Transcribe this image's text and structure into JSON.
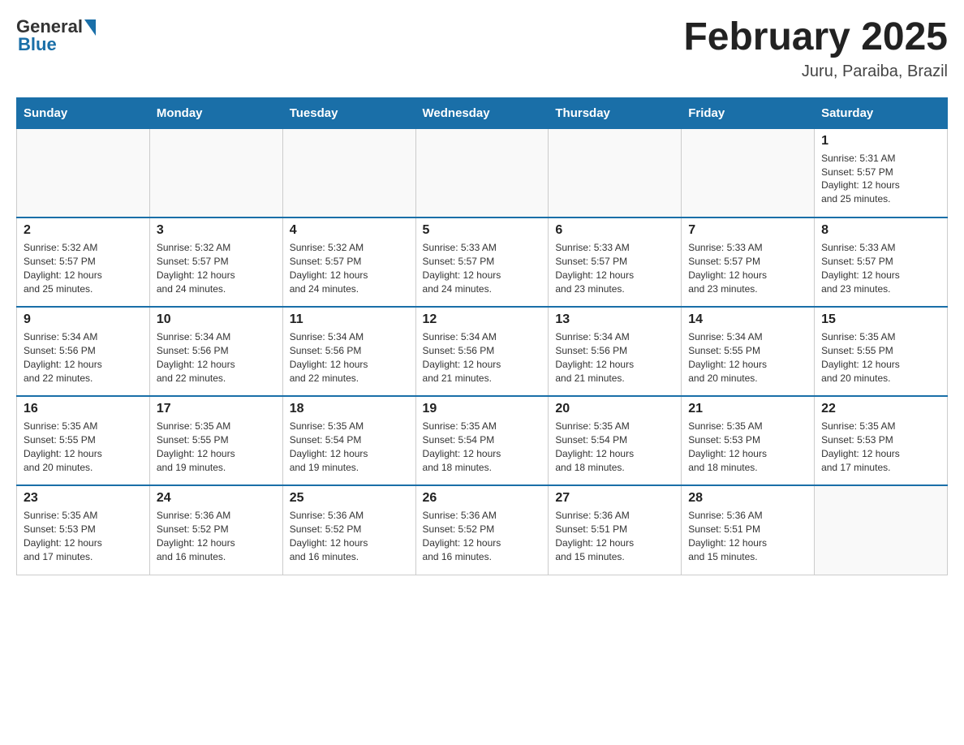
{
  "header": {
    "logo_general": "General",
    "logo_blue": "Blue",
    "month_title": "February 2025",
    "subtitle": "Juru, Paraiba, Brazil"
  },
  "weekdays": [
    "Sunday",
    "Monday",
    "Tuesday",
    "Wednesday",
    "Thursday",
    "Friday",
    "Saturday"
  ],
  "weeks": [
    [
      {
        "day": "",
        "info": ""
      },
      {
        "day": "",
        "info": ""
      },
      {
        "day": "",
        "info": ""
      },
      {
        "day": "",
        "info": ""
      },
      {
        "day": "",
        "info": ""
      },
      {
        "day": "",
        "info": ""
      },
      {
        "day": "1",
        "info": "Sunrise: 5:31 AM\nSunset: 5:57 PM\nDaylight: 12 hours\nand 25 minutes."
      }
    ],
    [
      {
        "day": "2",
        "info": "Sunrise: 5:32 AM\nSunset: 5:57 PM\nDaylight: 12 hours\nand 25 minutes."
      },
      {
        "day": "3",
        "info": "Sunrise: 5:32 AM\nSunset: 5:57 PM\nDaylight: 12 hours\nand 24 minutes."
      },
      {
        "day": "4",
        "info": "Sunrise: 5:32 AM\nSunset: 5:57 PM\nDaylight: 12 hours\nand 24 minutes."
      },
      {
        "day": "5",
        "info": "Sunrise: 5:33 AM\nSunset: 5:57 PM\nDaylight: 12 hours\nand 24 minutes."
      },
      {
        "day": "6",
        "info": "Sunrise: 5:33 AM\nSunset: 5:57 PM\nDaylight: 12 hours\nand 23 minutes."
      },
      {
        "day": "7",
        "info": "Sunrise: 5:33 AM\nSunset: 5:57 PM\nDaylight: 12 hours\nand 23 minutes."
      },
      {
        "day": "8",
        "info": "Sunrise: 5:33 AM\nSunset: 5:57 PM\nDaylight: 12 hours\nand 23 minutes."
      }
    ],
    [
      {
        "day": "9",
        "info": "Sunrise: 5:34 AM\nSunset: 5:56 PM\nDaylight: 12 hours\nand 22 minutes."
      },
      {
        "day": "10",
        "info": "Sunrise: 5:34 AM\nSunset: 5:56 PM\nDaylight: 12 hours\nand 22 minutes."
      },
      {
        "day": "11",
        "info": "Sunrise: 5:34 AM\nSunset: 5:56 PM\nDaylight: 12 hours\nand 22 minutes."
      },
      {
        "day": "12",
        "info": "Sunrise: 5:34 AM\nSunset: 5:56 PM\nDaylight: 12 hours\nand 21 minutes."
      },
      {
        "day": "13",
        "info": "Sunrise: 5:34 AM\nSunset: 5:56 PM\nDaylight: 12 hours\nand 21 minutes."
      },
      {
        "day": "14",
        "info": "Sunrise: 5:34 AM\nSunset: 5:55 PM\nDaylight: 12 hours\nand 20 minutes."
      },
      {
        "day": "15",
        "info": "Sunrise: 5:35 AM\nSunset: 5:55 PM\nDaylight: 12 hours\nand 20 minutes."
      }
    ],
    [
      {
        "day": "16",
        "info": "Sunrise: 5:35 AM\nSunset: 5:55 PM\nDaylight: 12 hours\nand 20 minutes."
      },
      {
        "day": "17",
        "info": "Sunrise: 5:35 AM\nSunset: 5:55 PM\nDaylight: 12 hours\nand 19 minutes."
      },
      {
        "day": "18",
        "info": "Sunrise: 5:35 AM\nSunset: 5:54 PM\nDaylight: 12 hours\nand 19 minutes."
      },
      {
        "day": "19",
        "info": "Sunrise: 5:35 AM\nSunset: 5:54 PM\nDaylight: 12 hours\nand 18 minutes."
      },
      {
        "day": "20",
        "info": "Sunrise: 5:35 AM\nSunset: 5:54 PM\nDaylight: 12 hours\nand 18 minutes."
      },
      {
        "day": "21",
        "info": "Sunrise: 5:35 AM\nSunset: 5:53 PM\nDaylight: 12 hours\nand 18 minutes."
      },
      {
        "day": "22",
        "info": "Sunrise: 5:35 AM\nSunset: 5:53 PM\nDaylight: 12 hours\nand 17 minutes."
      }
    ],
    [
      {
        "day": "23",
        "info": "Sunrise: 5:35 AM\nSunset: 5:53 PM\nDaylight: 12 hours\nand 17 minutes."
      },
      {
        "day": "24",
        "info": "Sunrise: 5:36 AM\nSunset: 5:52 PM\nDaylight: 12 hours\nand 16 minutes."
      },
      {
        "day": "25",
        "info": "Sunrise: 5:36 AM\nSunset: 5:52 PM\nDaylight: 12 hours\nand 16 minutes."
      },
      {
        "day": "26",
        "info": "Sunrise: 5:36 AM\nSunset: 5:52 PM\nDaylight: 12 hours\nand 16 minutes."
      },
      {
        "day": "27",
        "info": "Sunrise: 5:36 AM\nSunset: 5:51 PM\nDaylight: 12 hours\nand 15 minutes."
      },
      {
        "day": "28",
        "info": "Sunrise: 5:36 AM\nSunset: 5:51 PM\nDaylight: 12 hours\nand 15 minutes."
      },
      {
        "day": "",
        "info": ""
      }
    ]
  ]
}
